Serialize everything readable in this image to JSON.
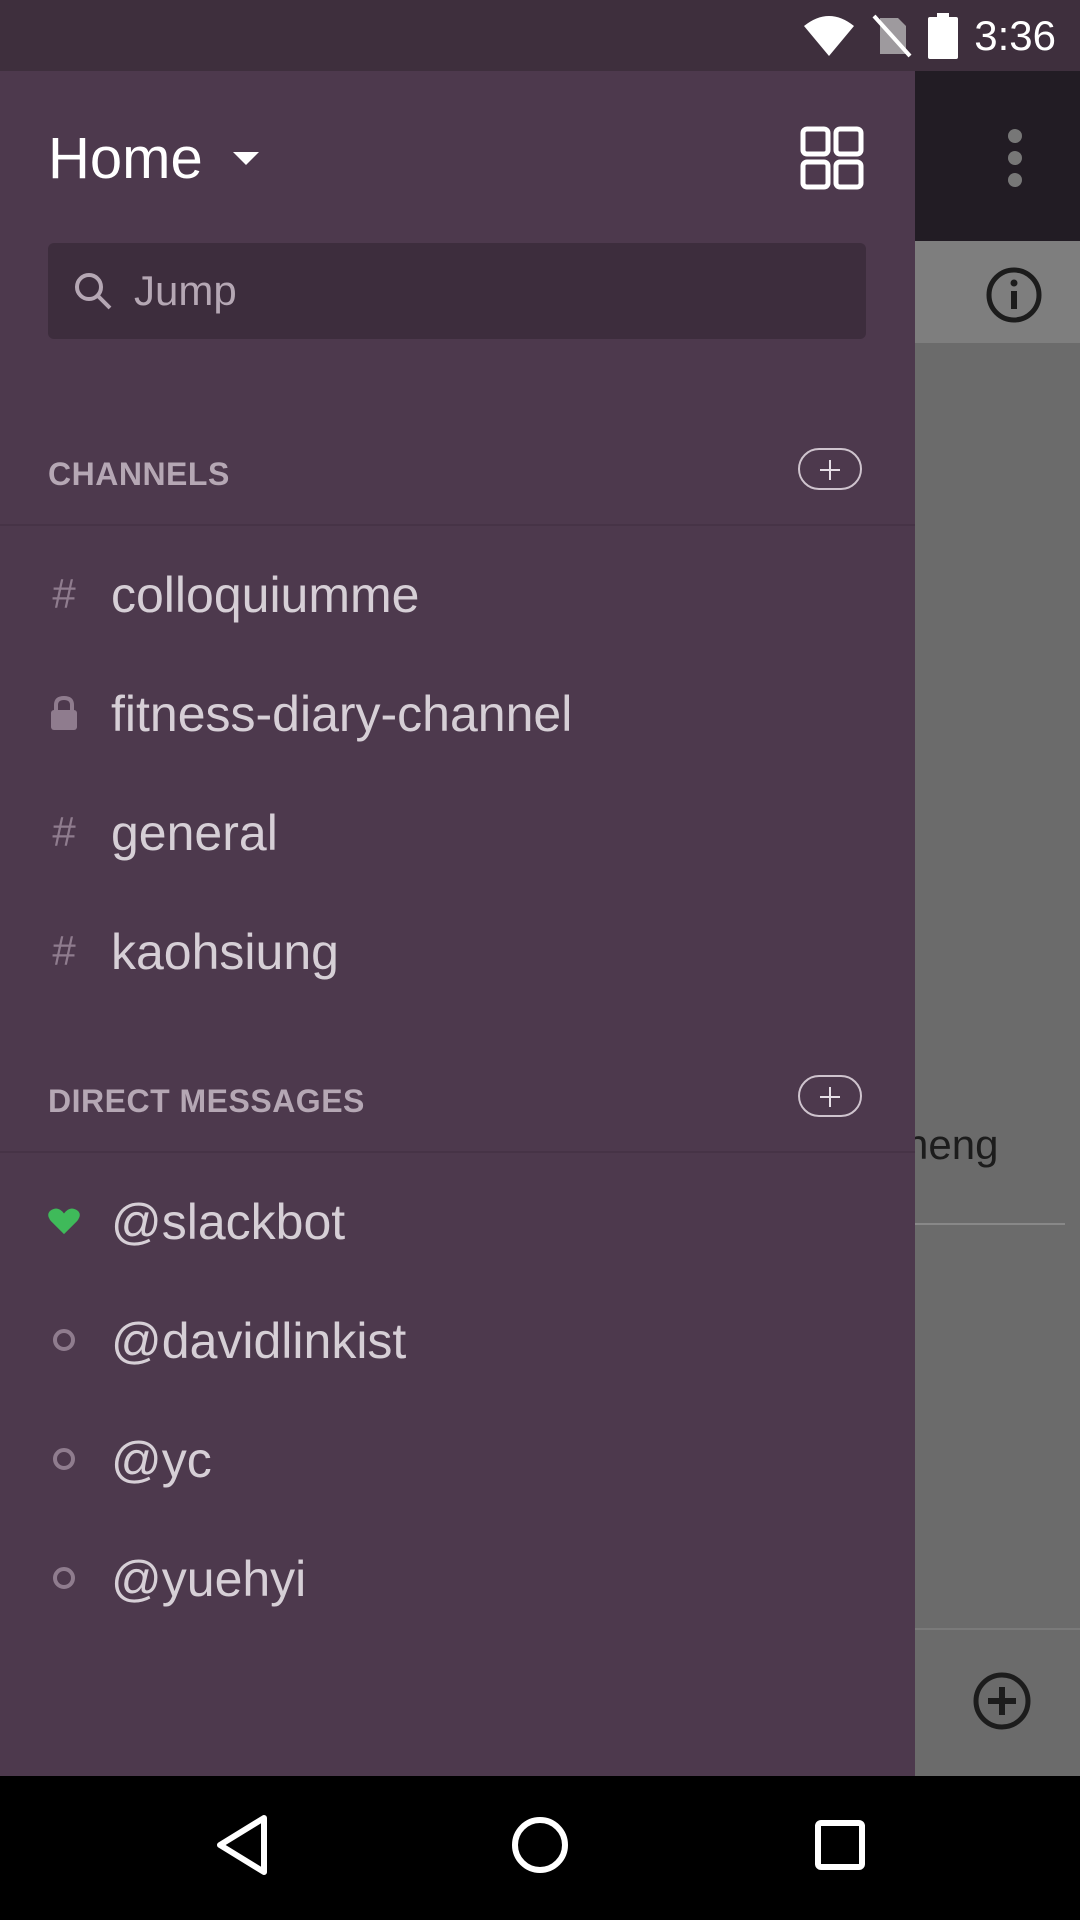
{
  "status_bar": {
    "time": "3:36"
  },
  "drawer": {
    "title": "Home",
    "search": {
      "placeholder": "Jump"
    },
    "channels": {
      "header": "CHANNELS",
      "items": [
        {
          "name": "colloquiumme",
          "icon": "hash-icon"
        },
        {
          "name": "fitness-diary-channel",
          "icon": "lock-icon"
        },
        {
          "name": "general",
          "icon": "hash-icon"
        },
        {
          "name": "kaohsiung",
          "icon": "hash-icon"
        }
      ]
    },
    "direct_messages": {
      "header": "DIRECT MESSAGES",
      "items": [
        {
          "name": "@slackbot",
          "icon": "heart-icon"
        },
        {
          "name": "@davidlinkist",
          "icon": "presence-away-icon"
        },
        {
          "name": "@yc",
          "icon": "presence-away-icon"
        },
        {
          "name": "@yuehyi",
          "icon": "presence-away-icon"
        }
      ]
    }
  },
  "background": {
    "partial_text": "heng"
  },
  "colors": {
    "drawer_bg": "#4d394d",
    "search_bg": "#3d2d3d",
    "slackbot_heart": "#3fba5a"
  }
}
